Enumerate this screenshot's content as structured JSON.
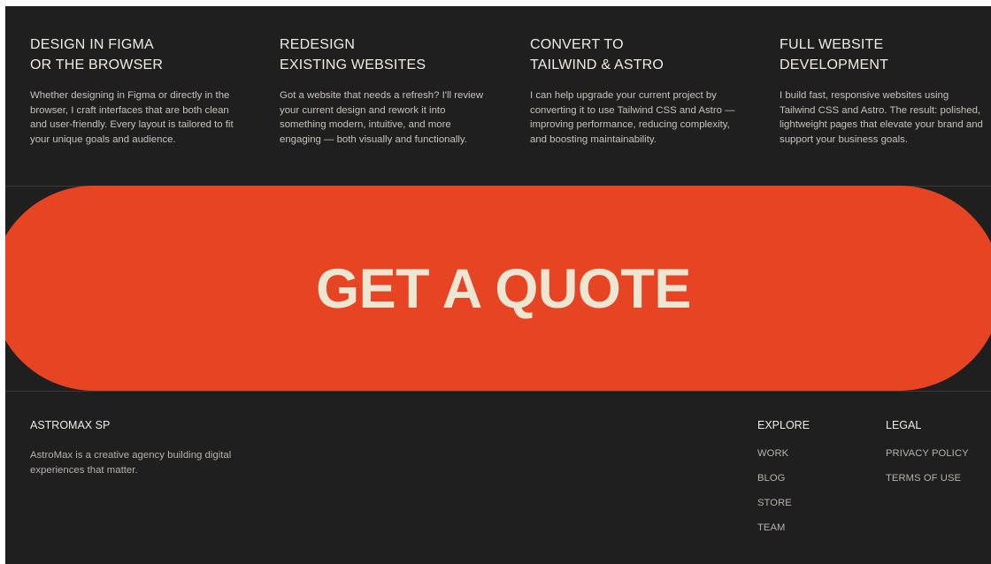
{
  "services": [
    {
      "title_line1": "DESIGN IN FIGMA",
      "title_line2": "OR THE BROWSER",
      "description": "Whether designing in Figma or directly in the browser, I craft interfaces that are both clean and user-friendly. Every layout is tailored to fit your unique goals and audience."
    },
    {
      "title_line1": "REDESIGN",
      "title_line2": "EXISTING WEBSITES",
      "description": "Got a website that needs a refresh? I'll review your current design and rework it into something modern, intuitive, and more engaging — both visually and functionally."
    },
    {
      "title_line1": "CONVERT TO",
      "title_line2": "TAILWIND & ASTRO",
      "description": "I can help upgrade your current project by converting it to use Tailwind CSS and Astro — improving performance, reducing complexity, and boosting maintainability."
    },
    {
      "title_line1": "FULL WEBSITE",
      "title_line2": "DEVELOPMENT",
      "description": "I build fast, responsive websites using Tailwind CSS and Astro. The result: polished, lightweight pages that elevate your brand and support your business goals."
    }
  ],
  "cta": {
    "label": "GET A QUOTE"
  },
  "footer": {
    "brand": "ASTROMAX SP",
    "brand_description": "AstroMax is a creative agency building digital experiences that matter.",
    "explore": {
      "title": "EXPLORE",
      "links": [
        "WORK",
        "BLOG",
        "STORE",
        "TEAM"
      ]
    },
    "legal": {
      "title": "LEGAL",
      "links": [
        "PRIVACY POLICY",
        "TERMS OF USE"
      ]
    }
  },
  "colors": {
    "background": "#1f1f1f",
    "accent": "#e64422",
    "text": "#ece7da"
  }
}
